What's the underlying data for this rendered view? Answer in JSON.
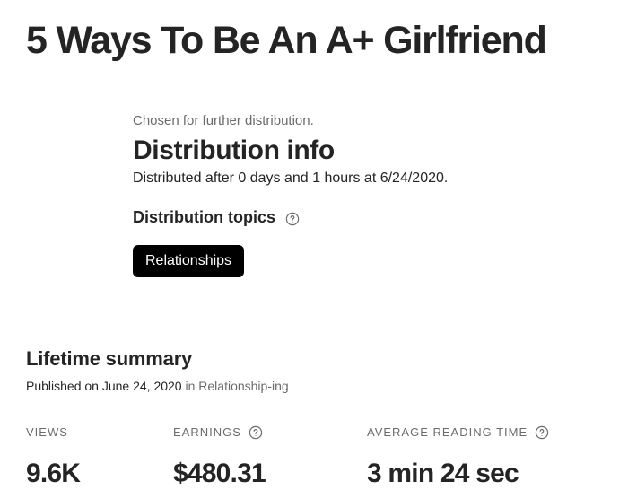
{
  "article": {
    "title": "5 Ways To Be An A+ Girlfriend"
  },
  "distribution": {
    "note": "Chosen for further distribution.",
    "heading": "Distribution info",
    "detail": "Distributed after 0 days and 1 hours at 6/24/2020.",
    "topics_label": "Distribution topics",
    "topics": [
      "Relationships"
    ]
  },
  "summary": {
    "heading": "Lifetime summary",
    "published": "Published on June 24, 2020",
    "in_word": "in",
    "publication": "Relationship-ing"
  },
  "stats": [
    {
      "label": "VIEWS",
      "value": "9.6K",
      "help": false
    },
    {
      "label": "EARNINGS",
      "value": "$480.31",
      "help": true
    },
    {
      "label": "AVERAGE READING TIME",
      "value": "3 min 24 sec",
      "help": true
    }
  ],
  "icons": {
    "help": "question-circle-icon"
  },
  "colors": {
    "text": "#242424",
    "muted": "#6b6b6b",
    "chip_bg": "#000000",
    "chip_text": "#ffffff"
  }
}
